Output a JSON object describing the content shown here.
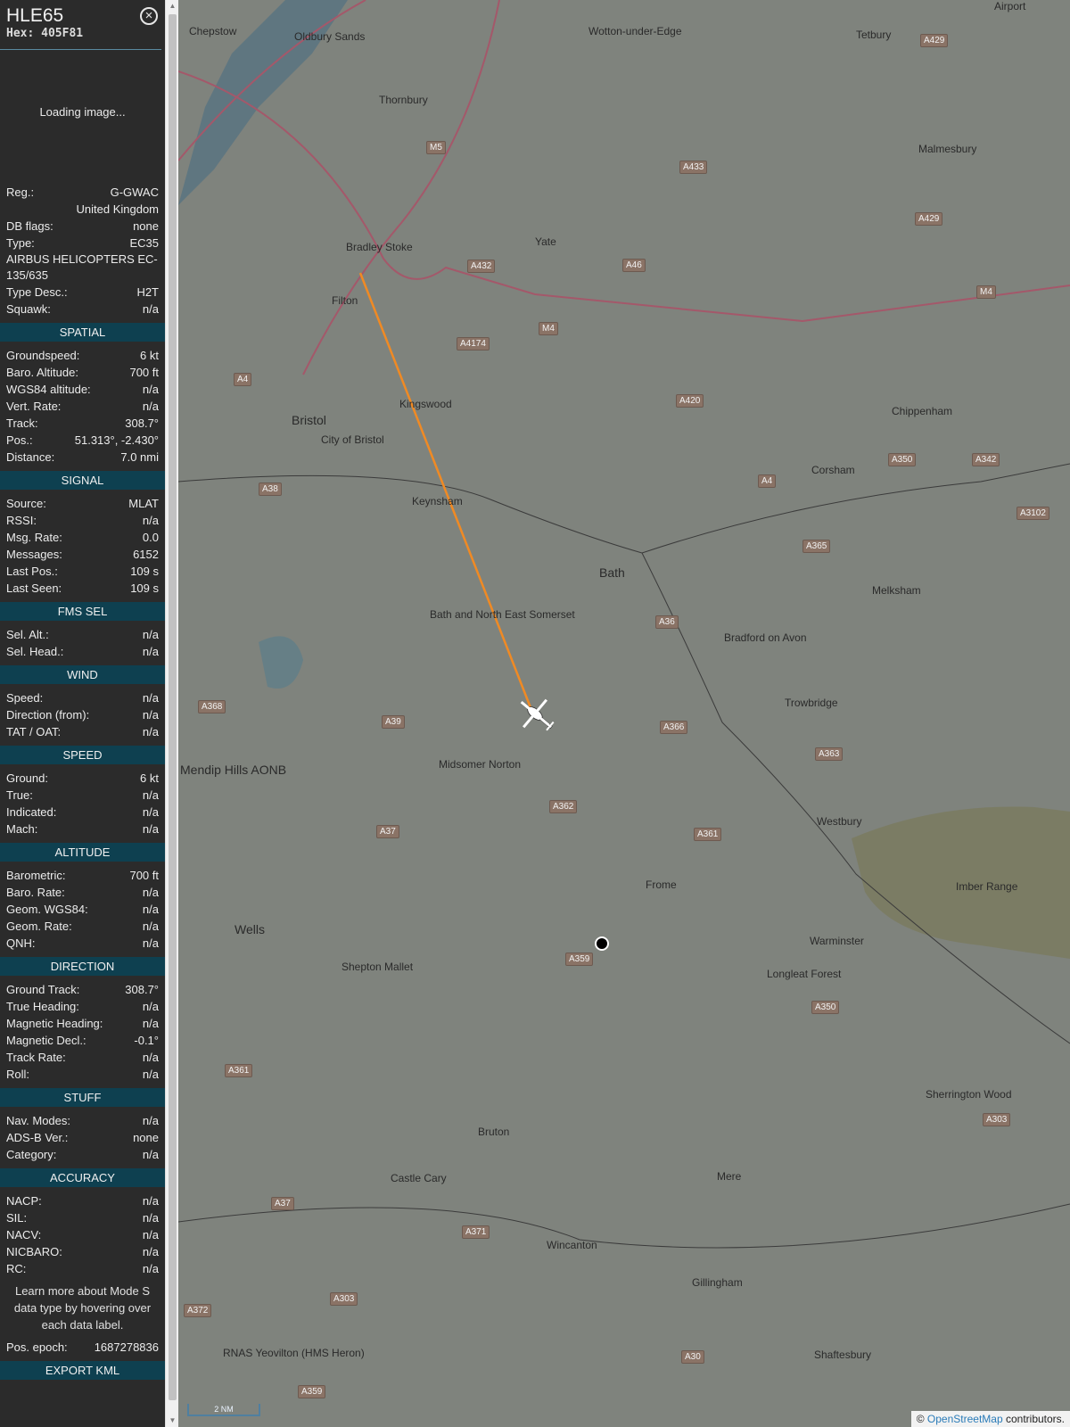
{
  "header": {
    "callsign": "HLE65",
    "hex": "Hex: 405F81"
  },
  "image_status": "Loading image...",
  "info": [
    {
      "label": "Reg.:",
      "value": "G-GWAC"
    },
    {
      "label": "",
      "value": "United Kingdom"
    },
    {
      "label": "DB flags:",
      "value": "none"
    },
    {
      "label": "Type:",
      "value": "EC35"
    },
    {
      "label": "AIRBUS HELICOPTERS EC-135/635",
      "value": ""
    },
    {
      "label": "Type Desc.:",
      "value": "H2T"
    },
    {
      "label": "Squawk:",
      "value": "n/a"
    }
  ],
  "sections": [
    {
      "title": "SPATIAL",
      "rows": [
        {
          "label": "Groundspeed:",
          "value": "6 kt"
        },
        {
          "label": "Baro. Altitude:",
          "value": "700 ft"
        },
        {
          "label": "WGS84 altitude:",
          "value": "n/a"
        },
        {
          "label": "Vert. Rate:",
          "value": "n/a"
        },
        {
          "label": "Track:",
          "value": "308.7°"
        },
        {
          "label": "Pos.:",
          "value": "51.313°, -2.430°"
        },
        {
          "label": "Distance:",
          "value": "7.0 nmi"
        }
      ]
    },
    {
      "title": "SIGNAL",
      "rows": [
        {
          "label": "Source:",
          "value": "MLAT"
        },
        {
          "label": "RSSI:",
          "value": "n/a"
        },
        {
          "label": "Msg. Rate:",
          "value": "0.0"
        },
        {
          "label": "Messages:",
          "value": "6152"
        },
        {
          "label": "Last Pos.:",
          "value": "109 s"
        },
        {
          "label": "Last Seen:",
          "value": "109 s"
        }
      ]
    },
    {
      "title": "FMS SEL",
      "rows": [
        {
          "label": "Sel. Alt.:",
          "value": "n/a"
        },
        {
          "label": "Sel. Head.:",
          "value": "n/a"
        }
      ]
    },
    {
      "title": "WIND",
      "rows": [
        {
          "label": "Speed:",
          "value": "n/a"
        },
        {
          "label": "Direction (from):",
          "value": "n/a"
        },
        {
          "label": "TAT / OAT:",
          "value": "n/a"
        }
      ]
    },
    {
      "title": "SPEED",
      "rows": [
        {
          "label": "Ground:",
          "value": "6 kt"
        },
        {
          "label": "True:",
          "value": "n/a"
        },
        {
          "label": "Indicated:",
          "value": "n/a"
        },
        {
          "label": "Mach:",
          "value": "n/a"
        }
      ]
    },
    {
      "title": "ALTITUDE",
      "rows": [
        {
          "label": "Barometric:",
          "value": "700 ft"
        },
        {
          "label": "Baro. Rate:",
          "value": "n/a"
        },
        {
          "label": "Geom. WGS84:",
          "value": "n/a"
        },
        {
          "label": "Geom. Rate:",
          "value": "n/a"
        },
        {
          "label": "QNH:",
          "value": "n/a"
        }
      ]
    },
    {
      "title": "DIRECTION",
      "rows": [
        {
          "label": "Ground Track:",
          "value": "308.7°"
        },
        {
          "label": "True Heading:",
          "value": "n/a"
        },
        {
          "label": "Magnetic Heading:",
          "value": "n/a"
        },
        {
          "label": "Magnetic Decl.:",
          "value": "-0.1°"
        },
        {
          "label": "Track Rate:",
          "value": "n/a"
        },
        {
          "label": "Roll:",
          "value": "n/a"
        }
      ]
    },
    {
      "title": "STUFF",
      "rows": [
        {
          "label": "Nav. Modes:",
          "value": "n/a"
        },
        {
          "label": "ADS-B Ver.:",
          "value": "none"
        },
        {
          "label": "Category:",
          "value": "n/a"
        }
      ]
    },
    {
      "title": "ACCURACY",
      "rows": [
        {
          "label": "NACP:",
          "value": "n/a"
        },
        {
          "label": "SIL:",
          "value": "n/a"
        },
        {
          "label": "NACV:",
          "value": "n/a"
        },
        {
          "label": "NICBARO:",
          "value": "n/a"
        },
        {
          "label": "RC:",
          "value": "n/a"
        }
      ]
    }
  ],
  "note": "Learn more about Mode S data type by hovering over each data label.",
  "pos_epoch": {
    "label": "Pos. epoch:",
    "value": "1687278836"
  },
  "export_label": "EXPORT KML",
  "map": {
    "places": [
      {
        "name": "Chepstow",
        "cls": ""
      },
      {
        "name": "Oldbury Sands",
        "cls": ""
      },
      {
        "name": "Wotton-under-Edge",
        "cls": ""
      },
      {
        "name": "Tetbury",
        "cls": ""
      },
      {
        "name": "Thornbury",
        "cls": ""
      },
      {
        "name": "Malmesbury",
        "cls": ""
      },
      {
        "name": "Yate",
        "cls": ""
      },
      {
        "name": "Bradley Stoke",
        "cls": ""
      },
      {
        "name": "Filton",
        "cls": ""
      },
      {
        "name": "Kingswood",
        "cls": ""
      },
      {
        "name": "Bristol",
        "cls": "big"
      },
      {
        "name": "Chippenham",
        "cls": ""
      },
      {
        "name": "Corsham",
        "cls": ""
      },
      {
        "name": "Keynsham",
        "cls": ""
      },
      {
        "name": "Bath",
        "cls": "big"
      },
      {
        "name": "Melksham",
        "cls": ""
      },
      {
        "name": "Bath and North East Somerset",
        "cls": ""
      },
      {
        "name": "Bradford on Avon",
        "cls": ""
      },
      {
        "name": "Trowbridge",
        "cls": ""
      },
      {
        "name": "Midsomer Norton",
        "cls": ""
      },
      {
        "name": "Mendip Hills AONB",
        "cls": "big"
      },
      {
        "name": "Westbury",
        "cls": ""
      },
      {
        "name": "Frome",
        "cls": ""
      },
      {
        "name": "Imber Range",
        "cls": ""
      },
      {
        "name": "Wells",
        "cls": "big"
      },
      {
        "name": "Warminster",
        "cls": ""
      },
      {
        "name": "Shepton Mallet",
        "cls": ""
      },
      {
        "name": "Longleat Forest",
        "cls": ""
      },
      {
        "name": "Bruton",
        "cls": ""
      },
      {
        "name": "Sherrington Wood",
        "cls": ""
      },
      {
        "name": "Castle Cary",
        "cls": ""
      },
      {
        "name": "Mere",
        "cls": ""
      },
      {
        "name": "Wincanton",
        "cls": ""
      },
      {
        "name": "Gillingham",
        "cls": ""
      },
      {
        "name": "RNAS Yeovilton (HMS Heron)",
        "cls": ""
      },
      {
        "name": "Shaftesbury",
        "cls": ""
      },
      {
        "name": "City of Bristol",
        "cls": ""
      },
      {
        "name": "Airport",
        "cls": ""
      }
    ],
    "roads": [
      "A429",
      "M5",
      "A433",
      "A429",
      "A432",
      "A46",
      "M4",
      "A4174",
      "M4",
      "A420",
      "A4",
      "A4",
      "A342",
      "A350",
      "A3102",
      "A38",
      "A365",
      "A36",
      "A368",
      "A39",
      "A366",
      "A363",
      "A362",
      "A37",
      "A361",
      "A359",
      "A350",
      "A361",
      "A303",
      "A371",
      "A37",
      "A303",
      "A372",
      "A30",
      "A359"
    ],
    "scale_label": "2 NM",
    "attribution_prefix": "©",
    "attribution_link": "OpenStreetMap",
    "attribution_suffix": "contributors."
  }
}
